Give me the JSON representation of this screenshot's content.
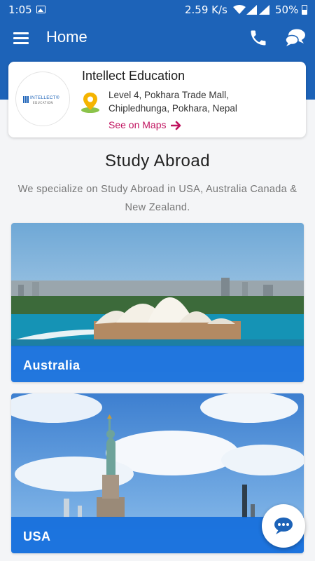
{
  "status_bar": {
    "time": "1:05",
    "net_speed": "2.59 K/s",
    "battery": "50%"
  },
  "app_bar": {
    "title": "Home"
  },
  "institution": {
    "name": "Intellect Education",
    "address_line1": "Level 4, Pokhara Trade Mall,",
    "address_line2": "Chipledhunga, Pokhara, Nepal",
    "maps_link": "See on Maps",
    "logo_text": "INTELLECT®",
    "logo_subtext": "EDUCATION"
  },
  "study_abroad": {
    "title": "Study Abroad",
    "description": "We specialize on Study Abroad in USA, Australia Canada & New Zealand."
  },
  "countries": [
    {
      "name": "Australia"
    },
    {
      "name": "USA"
    }
  ],
  "colors": {
    "primary": "#1d63b8",
    "accent_link": "#c0135f",
    "card_label": "#146edc"
  },
  "icons": {
    "menu": "menu-icon",
    "phone": "phone-icon",
    "chat": "chat-bubbles-icon",
    "location": "map-pin-icon",
    "fab": "chat-fab-icon"
  }
}
